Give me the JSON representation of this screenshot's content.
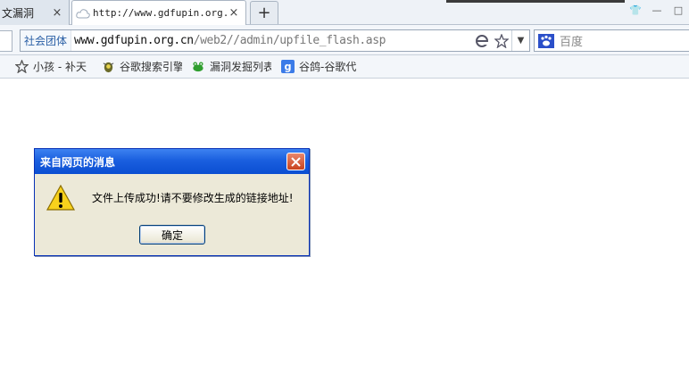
{
  "tabs": [
    {
      "title": "文漏洞",
      "close": "×"
    },
    {
      "title": "http://www.gdfupin.org.cn",
      "close": "×"
    }
  ],
  "new_tab_label": "+",
  "window_controls": [
    "👕",
    "—",
    "□"
  ],
  "address_bar": {
    "site_id": "社会团体",
    "url_host": "www.gdfupin.org.cn",
    "url_path": "/web2//admin/upfile_flash.asp",
    "dropdown": "▼"
  },
  "search_bar": {
    "placeholder": "百度"
  },
  "bookmarks": [
    {
      "label": "小孩 - 补天",
      "icon": "star-icon"
    },
    {
      "label": "谷歌搜索引擎",
      "icon": "bug-icon"
    },
    {
      "label": "漏洞发掘列表",
      "icon": "frog-icon"
    },
    {
      "label": "谷鸽-谷歌代",
      "icon": "google-g-icon"
    }
  ],
  "dialog": {
    "title": "来自网页的消息",
    "message": "文件上传成功!请不要修改生成的链接地址!",
    "ok_label": "确定"
  },
  "colors": {
    "dialog_title_bg": "#1a5fdf",
    "dialog_bg": "#ece9d8",
    "close_btn": "#d9582f",
    "site_id_text": "#2a5fa5"
  }
}
